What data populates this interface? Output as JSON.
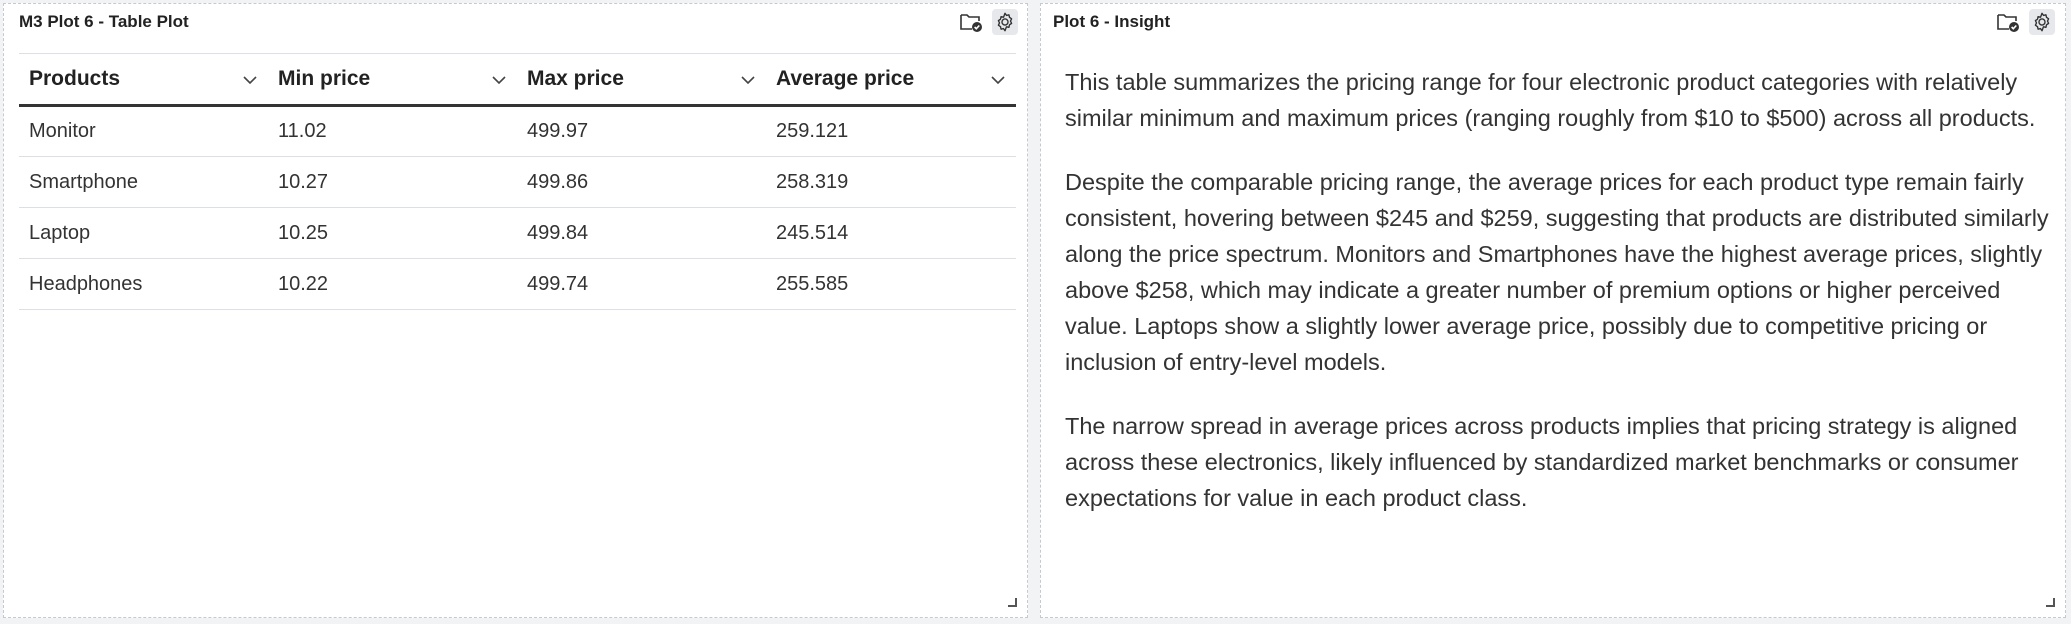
{
  "left_panel": {
    "title": "M3 Plot 6 - Table Plot",
    "table": {
      "columns": [
        "Products",
        "Min price",
        "Max price",
        "Average price"
      ],
      "rows": [
        [
          "Monitor",
          "11.02",
          "499.97",
          "259.121"
        ],
        [
          "Smartphone",
          "10.27",
          "499.86",
          "258.319"
        ],
        [
          "Laptop",
          "10.25",
          "499.84",
          "245.514"
        ],
        [
          "Headphones",
          "10.22",
          "499.74",
          "255.585"
        ]
      ]
    }
  },
  "right_panel": {
    "title": "Plot 6 - Insight",
    "paragraphs": [
      "This table summarizes the pricing range for four electronic product categories with relatively similar minimum and maximum prices (ranging roughly from $10 to $500) across all products.",
      "Despite the comparable pricing range, the average prices for each product type remain fairly consistent, hovering between $245 and $259, suggesting that products are distributed similarly along the price spectrum. Monitors and Smartphones have the highest average prices, slightly above $258, which may indicate a greater number of premium options or higher perceived value. Laptops show a slightly lower average price, possibly due to competitive pricing or inclusion of entry-level models.",
      "The narrow spread in average prices across products implies that pricing strategy is aligned across these electronics, likely influenced by standardized market benchmarks or consumer expectations for value in each product class."
    ]
  },
  "icons": {
    "folder": "folder-check-icon",
    "settings": "gear-icon",
    "sort": "chevron-down-icon",
    "resize": "resize-handle-icon"
  },
  "colors": {
    "panel_bg": "#ffffff",
    "page_bg": "#f2f3f5",
    "text": "#222222",
    "header_rule": "#333333",
    "row_border": "#dcdfe4"
  }
}
